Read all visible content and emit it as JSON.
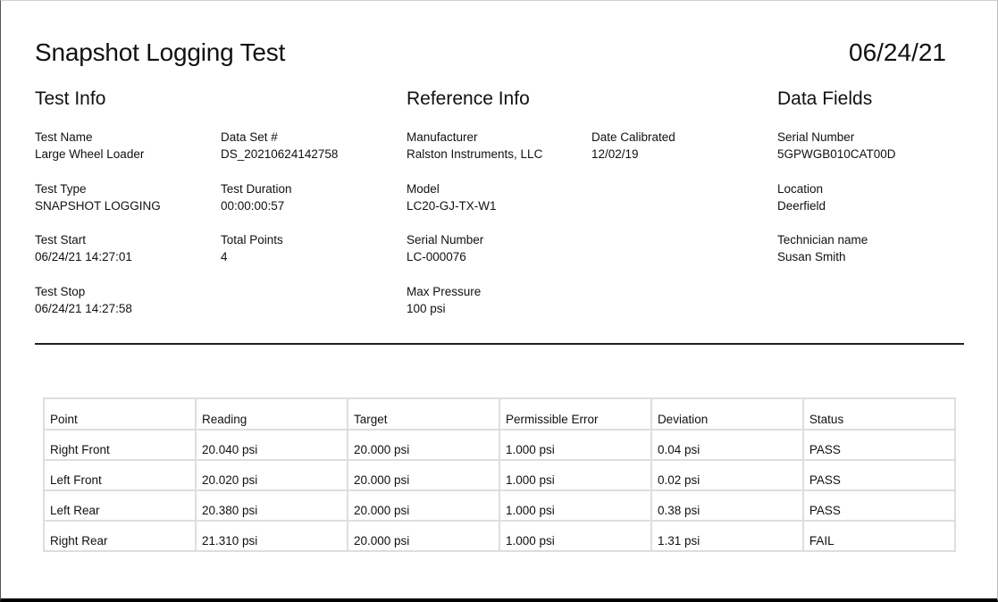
{
  "title": "Snapshot Logging Test",
  "date": "06/24/21",
  "sections": {
    "test_info": {
      "heading": "Test Info",
      "fields": [
        {
          "label": "Test Name",
          "value": "Large Wheel Loader"
        },
        {
          "label": "Data Set #",
          "value": "DS_20210624142758"
        },
        {
          "label": "Test Type",
          "value": "SNAPSHOT LOGGING"
        },
        {
          "label": "Test Duration",
          "value": "00:00:00:57"
        },
        {
          "label": "Test Start",
          "value": "06/24/21 14:27:01"
        },
        {
          "label": "Total Points",
          "value": "4"
        },
        {
          "label": "Test Stop",
          "value": "06/24/21 14:27:58"
        }
      ]
    },
    "reference_info": {
      "heading": "Reference Info",
      "fields": [
        {
          "label": "Manufacturer",
          "value": "Ralston Instruments, LLC"
        },
        {
          "label": "Date Calibrated",
          "value": "12/02/19"
        },
        {
          "label": "Model",
          "value": "LC20-GJ-TX-W1"
        },
        {
          "label": "Serial Number",
          "value": "LC-000076"
        },
        {
          "label": "Max Pressure",
          "value": "100 psi"
        }
      ]
    },
    "data_fields": {
      "heading": "Data Fields",
      "fields": [
        {
          "label": "Serial Number",
          "value": "5GPWGB010CAT00D"
        },
        {
          "label": "Location",
          "value": "Deerfield"
        },
        {
          "label": "Technician name",
          "value": "Susan Smith"
        }
      ]
    }
  },
  "table": {
    "headers": [
      "Point",
      "Reading",
      "Target",
      "Permissible Error",
      "Deviation",
      "Status"
    ],
    "rows": [
      [
        "Right Front",
        "20.040 psi",
        "20.000 psi",
        "1.000 psi",
        "0.04 psi",
        "PASS"
      ],
      [
        "Left Front",
        "20.020 psi",
        "20.000 psi",
        "1.000 psi",
        "0.02 psi",
        "PASS"
      ],
      [
        "Left Rear",
        "20.380 psi",
        "20.000 psi",
        "1.000 psi",
        "0.38 psi",
        "PASS"
      ],
      [
        "Right Rear",
        "21.310 psi",
        "20.000 psi",
        "1.000 psi",
        "1.31 psi",
        "FAIL"
      ]
    ]
  }
}
